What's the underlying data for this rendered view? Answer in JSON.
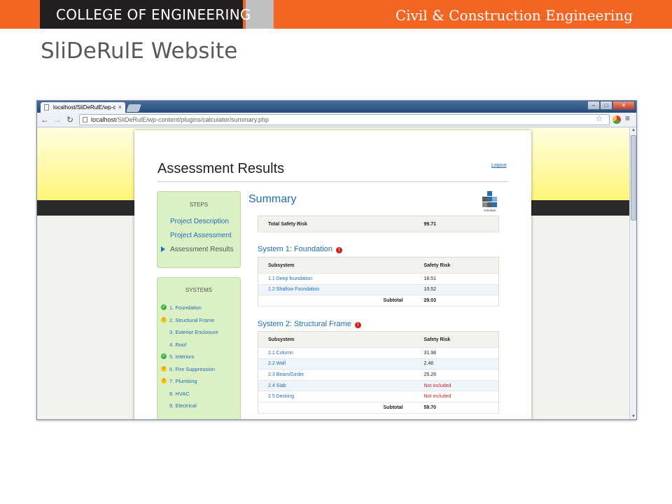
{
  "slide": {
    "college": "COLLEGE OF ENGINEERING",
    "department": "Civil & Construction Engineering",
    "title": "SliDeRulE Website"
  },
  "browser": {
    "tab_title": "localhost/SliDeRulE/wp-c",
    "tab_close": "×",
    "url_host": "localhost",
    "url_path": "/SliDeRulE/wp-content/plugins/calculator/summary.php",
    "icons": [
      "back-arrow-icon",
      "forward-arrow-icon",
      "reload-icon",
      "bookmark-star-icon",
      "extension-icon",
      "menu-icon"
    ]
  },
  "page": {
    "title": "Assessment Results",
    "logout": "Logout",
    "steps": {
      "heading": "STEPS",
      "items": [
        {
          "label": "Project Description",
          "current": false
        },
        {
          "label": "Project Assessment",
          "current": false
        },
        {
          "label": "Assessment Results",
          "current": true
        }
      ]
    },
    "systems": {
      "heading": "SYSTEMS",
      "items": [
        {
          "label": "1. Foundation",
          "status": "complete"
        },
        {
          "label": "2. Structural Frame",
          "status": "warning"
        },
        {
          "label": "3. Exterior Enclosure",
          "status": "none"
        },
        {
          "label": "4. Roof",
          "status": "none"
        },
        {
          "label": "5. Interiors",
          "status": "complete"
        },
        {
          "label": "6. Fire Suppression",
          "status": "warning"
        },
        {
          "label": "7. Plumbing",
          "status": "warning"
        },
        {
          "label": "8. HVAC",
          "status": "none"
        },
        {
          "label": "9. Electrical",
          "status": "none"
        }
      ]
    },
    "summary": {
      "title": "Summary",
      "logo_text": "SliDeRulE",
      "total_label": "Total Safety Risk",
      "total_value": "99.71",
      "col_subsystem": "Subsystem",
      "col_risk": "Safety Risk",
      "subtotal_label": "Subtotal",
      "systems": [
        {
          "title": "System 1: Foundation",
          "rows": [
            {
              "name": "1.1 Deep foundation",
              "risk": "18.51"
            },
            {
              "name": "1.2 Shallow Foundation",
              "risk": "10.52"
            }
          ],
          "subtotal": "29.03"
        },
        {
          "title": "System 2: Structural Frame",
          "rows": [
            {
              "name": "2.1 Column",
              "risk": "31.98"
            },
            {
              "name": "2.2 Wall",
              "risk": "2.46"
            },
            {
              "name": "2.3 Beam/Girder",
              "risk": "25.26"
            },
            {
              "name": "2.4 Slab",
              "risk": "Not included"
            },
            {
              "name": "2.5 Decking",
              "risk": "Not included"
            }
          ],
          "subtotal": "59.70"
        }
      ]
    }
  },
  "colors": {
    "brand_orange": "#f26522",
    "header_black": "#231f20",
    "link_blue": "#1f6db8",
    "sidebar_green": "#dcf0c6",
    "alert_red": "#d71d1d"
  }
}
